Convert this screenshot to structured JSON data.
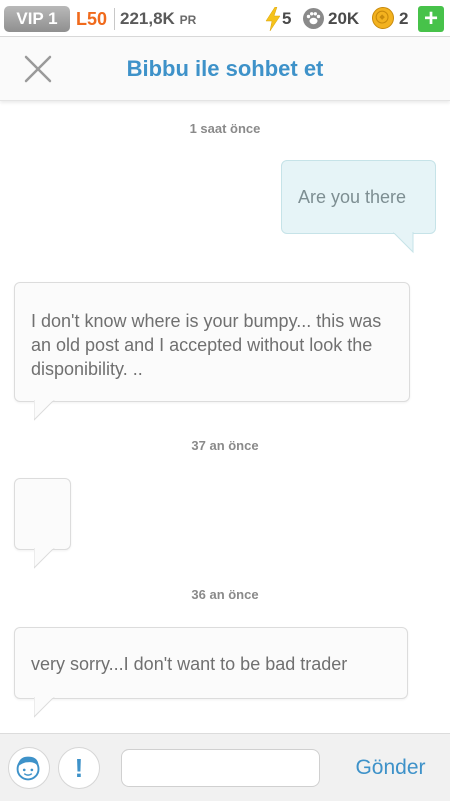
{
  "topbar": {
    "vip": "VIP 1",
    "level": "L50",
    "pr_value": "221,8K",
    "pr_unit": "PR",
    "energy": "5",
    "paws": "20K",
    "coins": "2",
    "plus_label": "+"
  },
  "header": {
    "title": "Bibbu ile sohbet et",
    "close_icon": "close-icon"
  },
  "messages": [
    {
      "timestamp": "1 saat önce",
      "direction": "outgoing",
      "text": "Are you there"
    },
    {
      "direction": "incoming",
      "text": "I don't know where is your bumpy... this was an old post and I accepted without look the disponibility. .."
    },
    {
      "timestamp": "37 an önce",
      "direction": "incoming",
      "text": ""
    },
    {
      "timestamp": "36 an önce",
      "direction": "incoming",
      "text": "very sorry...I don't want to be bad trader"
    }
  ],
  "composer": {
    "input_value": "",
    "send_label": "Gönder",
    "report_label": "!",
    "avatar_icon": "avatar-icon"
  },
  "colors": {
    "accent": "#3e92c9",
    "level": "#f06a1c",
    "plus": "#47c24a",
    "outgoing_bubble": "#e6f4f7"
  }
}
